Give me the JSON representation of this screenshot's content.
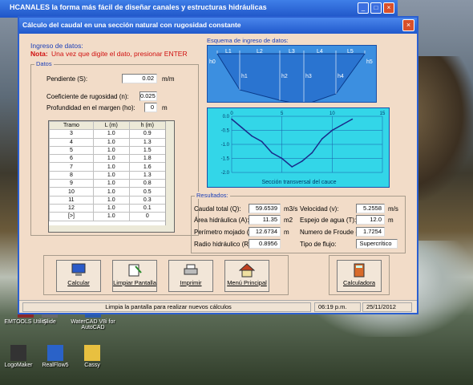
{
  "main_window": {
    "title": "HCANALES  la forma más fácil de diseñar canales y estructuras hidráulicas"
  },
  "dialog": {
    "title": "Cálculo del caudal en una sección natural con  rugosidad constante",
    "intro": "Ingreso de datos:",
    "note_label": "Nota:",
    "note_text": "Una vez que digite el dato, presionar ENTER",
    "close_label": "×"
  },
  "datos": {
    "group_title": "Datos",
    "pendiente_label": "Pendiente (S):",
    "pendiente_value": "0.02",
    "pendiente_unit": "m/m",
    "rugosidad_label": "Coeficiente de rugosidad (n):",
    "rugosidad_value": "0.025",
    "prof_label": "Profundidad en el margen (ho):",
    "prof_value": "0",
    "prof_unit": "m"
  },
  "table": {
    "headers": [
      "Tramo",
      "L (m)",
      "h (m)"
    ],
    "rows": [
      [
        "3",
        "1.0",
        "0.9"
      ],
      [
        "4",
        "1.0",
        "1.3"
      ],
      [
        "5",
        "1.0",
        "1.5"
      ],
      [
        "6",
        "1.0",
        "1.8"
      ],
      [
        "7",
        "1.0",
        "1.6"
      ],
      [
        "8",
        "1.0",
        "1.3"
      ],
      [
        "9",
        "1.0",
        "0.8"
      ],
      [
        "10",
        "1.0",
        "0.5"
      ],
      [
        "11",
        "1.0",
        "0.3"
      ],
      [
        "12",
        "1.0",
        "0.1"
      ],
      [
        "[>]",
        "1.0",
        "0"
      ]
    ]
  },
  "schema": {
    "title": "Esquema de ingreso de datos:",
    "segments": [
      "L1",
      "L2",
      "L3",
      "L4",
      "L5"
    ],
    "heights": [
      "h0",
      "h1",
      "h2",
      "h3",
      "h4",
      "h5"
    ]
  },
  "chart_data": {
    "type": "line",
    "title": "Sección transversal del cauce",
    "x_ticks": [
      "0",
      "5",
      "10",
      "15"
    ],
    "y_ticks": [
      "0.0",
      "-0.5",
      "-1.0",
      "-1.5",
      "-2.0"
    ],
    "xlim": [
      0,
      15
    ],
    "ylim": [
      -2.0,
      0.0
    ],
    "grid": true,
    "x": [
      0,
      1,
      2,
      3,
      4,
      5,
      6,
      7,
      8,
      9,
      10,
      11,
      12
    ],
    "y": [
      -0.1,
      -0.4,
      -0.7,
      -0.9,
      -1.3,
      -1.5,
      -1.8,
      -1.6,
      -1.3,
      -0.8,
      -0.5,
      -0.3,
      -0.1
    ]
  },
  "resultados": {
    "group_title": "Resultados:",
    "caudal_label": "Caudal total (Q):",
    "caudal_value": "59.6539",
    "caudal_unit": "m3/s",
    "velocidad_label": "Velocidad (v):",
    "velocidad_value": "5.2558",
    "velocidad_unit": "m/s",
    "area_label": "Área hidráulica (A):",
    "area_value": "11.35",
    "area_unit": "m2",
    "espejo_label": "Espejo de agua (T):",
    "espejo_value": "12.0",
    "espejo_unit": "m",
    "perimetro_label": "Perímetro mojado (p):",
    "perimetro_value": "12.6734",
    "perimetro_unit": "m",
    "froude_label": "Numero de Froude (F):",
    "froude_value": "1.7254",
    "radio_label": "Radio hidráulico (R):",
    "radio_value": "0.8956",
    "flujo_label": "Tipo de flujo:",
    "flujo_value": "Supercrítico"
  },
  "buttons": {
    "calcular": "Calcular",
    "limpiar": "Limpiar Pantalla",
    "imprimir": "Imprimir",
    "menu": "Menú Principal",
    "calculadora": "Calculadora"
  },
  "status": {
    "message": "Limpia la pantalla para realizar nuevos cálculos",
    "time": "06:19 p.m.",
    "date": "25/11/2012"
  },
  "desktop": {
    "icons": [
      "EMTOOLS Utility",
      "Slide",
      "WaterCAD V8i for AutoCAD",
      "LogoMaker",
      "RealFlow5",
      "Cassy"
    ]
  }
}
